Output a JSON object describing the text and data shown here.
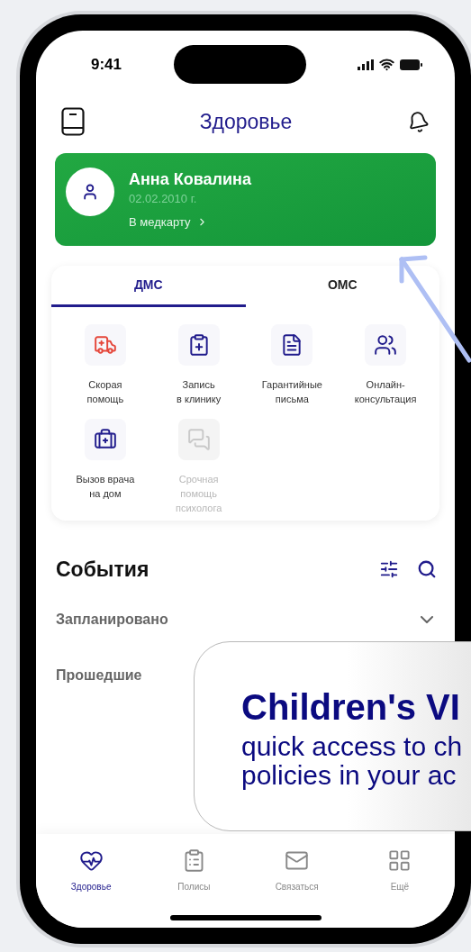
{
  "status_bar": {
    "time": "9:41"
  },
  "header": {
    "title": "Здоровье"
  },
  "profile": {
    "name": "Анна Ковалина",
    "birth_date": "02.02.2010 г.",
    "link": "В медкарту"
  },
  "tabs": [
    {
      "label": "ДМС",
      "selected": true
    },
    {
      "label": "ОМС",
      "selected": false
    }
  ],
  "services": [
    {
      "kind": "ambulance",
      "label": "Скорая\nпомощь",
      "disabled": false
    },
    {
      "kind": "appointment",
      "label": "Запись\nв клинику",
      "disabled": false
    },
    {
      "kind": "letters",
      "label": "Гарантийные\nписьма",
      "disabled": false
    },
    {
      "kind": "consultation",
      "label": "Онлайн-\nконсультация",
      "disabled": false
    },
    {
      "kind": "doctor_call",
      "label": "Вызов врача\nна дом",
      "disabled": false
    },
    {
      "kind": "psychologist",
      "label": "Срочная\nпомощь\nпсихолога",
      "disabled": true
    }
  ],
  "events": {
    "title": "События",
    "sections": [
      {
        "label": "Запланировано",
        "expanded": false
      },
      {
        "label": "Прошедшие"
      }
    ]
  },
  "callout": {
    "title": "Children's VI",
    "lines": [
      "quick access to ch",
      "policies in your ac"
    ]
  },
  "bottom_nav": [
    {
      "kind": "health",
      "label": "Здоровье",
      "selected": true
    },
    {
      "kind": "policies",
      "label": "Полисы",
      "selected": false
    },
    {
      "kind": "contact",
      "label": "Связаться",
      "selected": false
    },
    {
      "kind": "more",
      "label": "Ещё",
      "selected": false
    }
  ]
}
